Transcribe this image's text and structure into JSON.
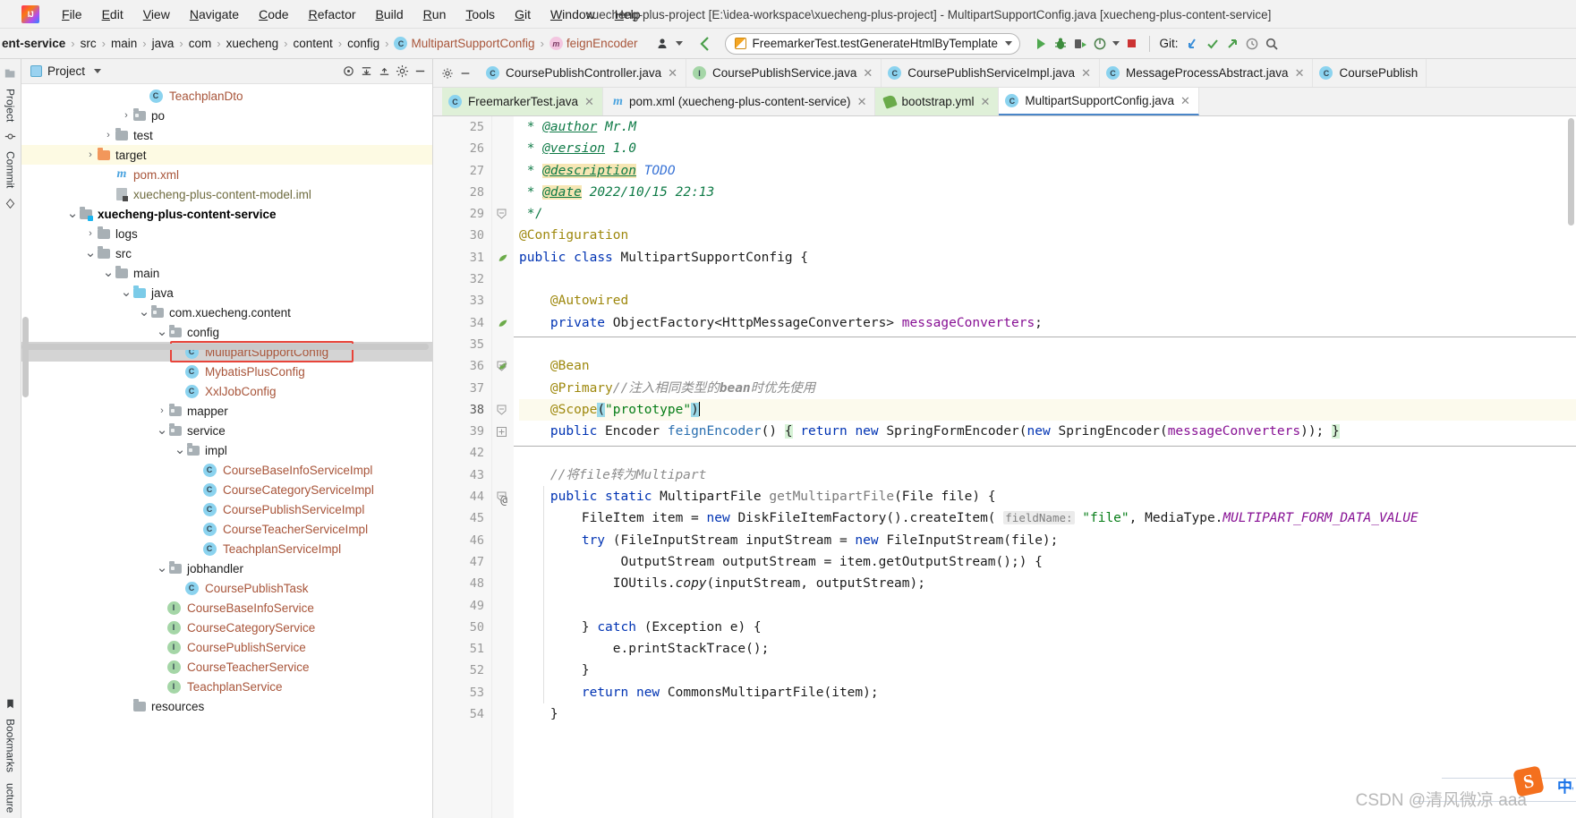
{
  "window": {
    "title": "xuecheng-plus-project [E:\\idea-workspace\\xuecheng-plus-project] - MultipartSupportConfig.java [xuecheng-plus-content-service]",
    "app_icon": "intellij-idea-logo"
  },
  "menubar": {
    "items": [
      {
        "label": "File",
        "mnemonic": "F"
      },
      {
        "label": "Edit",
        "mnemonic": "E"
      },
      {
        "label": "View",
        "mnemonic": "V"
      },
      {
        "label": "Navigate",
        "mnemonic": "N"
      },
      {
        "label": "Code",
        "mnemonic": "C"
      },
      {
        "label": "Refactor",
        "mnemonic": "R"
      },
      {
        "label": "Build",
        "mnemonic": "B"
      },
      {
        "label": "Run",
        "mnemonic": "R"
      },
      {
        "label": "Tools",
        "mnemonic": "T"
      },
      {
        "label": "Git",
        "mnemonic": "G"
      },
      {
        "label": "Window",
        "mnemonic": "W"
      },
      {
        "label": "Help",
        "mnemonic": "H"
      }
    ]
  },
  "navbar": {
    "breadcrumbs": [
      {
        "label": "ent-service",
        "type": "module",
        "bold": true
      },
      {
        "label": "src",
        "type": "dir"
      },
      {
        "label": "main",
        "type": "dir"
      },
      {
        "label": "java",
        "type": "dir"
      },
      {
        "label": "com",
        "type": "dir"
      },
      {
        "label": "xuecheng",
        "type": "dir"
      },
      {
        "label": "content",
        "type": "dir"
      },
      {
        "label": "config",
        "type": "dir"
      },
      {
        "label": "MultipartSupportConfig",
        "type": "class",
        "icon": "class-icon"
      },
      {
        "label": "feignEncoder",
        "type": "method",
        "icon": "method-icon"
      }
    ],
    "run_config": {
      "label": "FreemarkerTest.testGenerateHtmlByTemplate",
      "icon": "run-config-icon"
    },
    "buttons": [
      {
        "name": "run-button",
        "icon": "play-icon",
        "color": "#4fa84f"
      },
      {
        "name": "debug-button",
        "icon": "bug-icon",
        "color": "#3c8c3c"
      },
      {
        "name": "run-with-coverage-button",
        "icon": "coverage-icon"
      },
      {
        "name": "profiler-button",
        "icon": "profiler-icon"
      },
      {
        "name": "stop-button",
        "icon": "stop-icon",
        "color": "#cc3333"
      }
    ],
    "git_label": "Git:",
    "git_buttons": [
      {
        "name": "update-project-button",
        "icon": "update-icon"
      },
      {
        "name": "commit-button",
        "icon": "check-icon"
      },
      {
        "name": "push-button",
        "icon": "push-arrow-icon"
      },
      {
        "name": "history-button",
        "icon": "clock-icon"
      }
    ],
    "search_icon": "search-icon",
    "profiler_icon": "user-profile-icon",
    "back_icon": "back-arrow-icon"
  },
  "left_rail": {
    "items": [
      {
        "label": "Project",
        "name": "tool-window-project"
      },
      {
        "label": "Commit",
        "name": "tool-window-commit"
      },
      {
        "label": "Bookmarks",
        "name": "tool-window-bookmarks"
      },
      {
        "label": "ucture",
        "name": "tool-window-structure"
      }
    ]
  },
  "project_panel": {
    "title": "Project",
    "toolbar_icons": [
      "locate-icon",
      "expand-all-icon",
      "collapse-all-icon",
      "settings-gear-icon",
      "hide-icon"
    ],
    "tree": [
      {
        "label": "TeachplanDto",
        "indent": 7,
        "icon": "class-icon",
        "arrow": "none",
        "kind": "class"
      },
      {
        "label": "po",
        "indent": 6,
        "icon": "package-icon",
        "arrow": "collapsed",
        "kind": "package"
      },
      {
        "label": "test",
        "indent": 5,
        "icon": "folder-icon",
        "arrow": "collapsed",
        "kind": "dir"
      },
      {
        "label": "target",
        "indent": 4,
        "icon": "folder-target-icon",
        "arrow": "collapsed",
        "kind": "dir",
        "highlight": true
      },
      {
        "label": "pom.xml",
        "indent": 5,
        "icon": "maven-icon",
        "arrow": "none",
        "kind": "file"
      },
      {
        "label": "xuecheng-plus-content-model.iml",
        "indent": 5,
        "icon": "iml-icon",
        "arrow": "none",
        "kind": "iml"
      },
      {
        "label": "xuecheng-plus-content-service",
        "indent": 3,
        "icon": "module-icon",
        "arrow": "expanded",
        "kind": "module"
      },
      {
        "label": "logs",
        "indent": 4,
        "icon": "folder-icon",
        "arrow": "collapsed",
        "kind": "dir"
      },
      {
        "label": "src",
        "indent": 4,
        "icon": "folder-icon",
        "arrow": "expanded",
        "kind": "dir"
      },
      {
        "label": "main",
        "indent": 5,
        "icon": "folder-icon",
        "arrow": "expanded",
        "kind": "dir"
      },
      {
        "label": "java",
        "indent": 6,
        "icon": "source-folder-icon",
        "arrow": "expanded",
        "kind": "dir"
      },
      {
        "label": "com.xuecheng.content",
        "indent": 7,
        "icon": "package-icon",
        "arrow": "expanded",
        "kind": "package"
      },
      {
        "label": "config",
        "indent": 8,
        "icon": "package-icon",
        "arrow": "expanded",
        "kind": "package"
      },
      {
        "label": "MultipartSupportConfig",
        "indent": 9,
        "icon": "class-icon",
        "arrow": "none",
        "kind": "class",
        "selected": true,
        "annotated": true
      },
      {
        "label": "MybatisPlusConfig",
        "indent": 9,
        "icon": "class-icon",
        "arrow": "none",
        "kind": "class"
      },
      {
        "label": "XxlJobConfig",
        "indent": 9,
        "icon": "class-icon",
        "arrow": "none",
        "kind": "class"
      },
      {
        "label": "mapper",
        "indent": 8,
        "icon": "package-icon",
        "arrow": "collapsed",
        "kind": "package"
      },
      {
        "label": "service",
        "indent": 8,
        "icon": "package-icon",
        "arrow": "expanded",
        "kind": "package"
      },
      {
        "label": "impl",
        "indent": 9,
        "icon": "package-icon",
        "arrow": "expanded",
        "kind": "package"
      },
      {
        "label": "CourseBaseInfoServiceImpl",
        "indent": 10,
        "icon": "class-icon",
        "arrow": "none",
        "kind": "class"
      },
      {
        "label": "CourseCategoryServiceImpl",
        "indent": 10,
        "icon": "class-icon",
        "arrow": "none",
        "kind": "class"
      },
      {
        "label": "CoursePublishServiceImpl",
        "indent": 10,
        "icon": "class-icon",
        "arrow": "none",
        "kind": "class"
      },
      {
        "label": "CourseTeacherServiceImpl",
        "indent": 10,
        "icon": "class-icon",
        "arrow": "none",
        "kind": "class"
      },
      {
        "label": "TeachplanServiceImpl",
        "indent": 10,
        "icon": "class-icon",
        "arrow": "none",
        "kind": "class"
      },
      {
        "label": "jobhandler",
        "indent": 8,
        "icon": "package-icon",
        "arrow": "expanded",
        "kind": "package"
      },
      {
        "label": "CoursePublishTask",
        "indent": 9,
        "icon": "class-icon",
        "arrow": "none",
        "kind": "class"
      },
      {
        "label": "CourseBaseInfoService",
        "indent": 8,
        "icon": "interface-icon",
        "arrow": "none",
        "kind": "interface"
      },
      {
        "label": "CourseCategoryService",
        "indent": 8,
        "icon": "interface-icon",
        "arrow": "none",
        "kind": "interface"
      },
      {
        "label": "CoursePublishService",
        "indent": 8,
        "icon": "interface-icon",
        "arrow": "none",
        "kind": "interface"
      },
      {
        "label": "CourseTeacherService",
        "indent": 8,
        "icon": "interface-icon",
        "arrow": "none",
        "kind": "interface"
      },
      {
        "label": "TeachplanService",
        "indent": 8,
        "icon": "interface-icon",
        "arrow": "none",
        "kind": "interface"
      },
      {
        "label": "resources",
        "indent": 6,
        "icon": "resource-folder-icon",
        "arrow": "none",
        "kind": "dir"
      }
    ]
  },
  "editor": {
    "tabs_row1": [
      {
        "label": "CoursePublishController.java",
        "icon": "class-icon",
        "active": false,
        "closable": true
      },
      {
        "label": "CoursePublishService.java",
        "icon": "interface-icon",
        "active": false,
        "closable": true
      },
      {
        "label": "CoursePublishServiceImpl.java",
        "icon": "class-icon",
        "active": false,
        "closable": true
      },
      {
        "label": "MessageProcessAbstract.java",
        "icon": "abstract-class-icon",
        "active": false,
        "closable": true
      },
      {
        "label": "CoursePublish",
        "icon": "class-icon",
        "active": false,
        "closable": false
      }
    ],
    "tabs_row2": [
      {
        "label": "FreemarkerTest.java",
        "icon": "test-class-icon",
        "active": false,
        "green": true,
        "closable": true
      },
      {
        "label": "pom.xml (xuecheng-plus-content-service)",
        "icon": "maven-icon",
        "active": false,
        "closable": true
      },
      {
        "label": "bootstrap.yml",
        "icon": "yaml-icon",
        "active": false,
        "green": true,
        "closable": true
      },
      {
        "label": "MultipartSupportConfig.java",
        "icon": "class-icon",
        "active": true,
        "closable": true
      }
    ],
    "first_visible_line": 25,
    "current_line": 38,
    "lines": [
      {
        "n": "25",
        "text": " * @author Mr.M"
      },
      {
        "n": "26",
        "text": " * @version 1.0"
      },
      {
        "n": "27",
        "text": " * @description TODO"
      },
      {
        "n": "28",
        "text": " * @date 2022/10/15 22:13"
      },
      {
        "n": "29",
        "text": " */"
      },
      {
        "n": "30",
        "text": "@Configuration"
      },
      {
        "n": "31",
        "text": "public class MultipartSupportConfig {",
        "gutter_icon": "bean-icon"
      },
      {
        "n": "32",
        "text": ""
      },
      {
        "n": "33",
        "text": "    @Autowired"
      },
      {
        "n": "34",
        "text": "    private ObjectFactory<HttpMessageConverters> messageConverters;",
        "gutter_icon": "bean-inject-icon"
      },
      {
        "n": "35",
        "text": ""
      },
      {
        "n": "36",
        "text": "    @Bean",
        "gutter_icon": "bean-icon"
      },
      {
        "n": "37",
        "text": "    @Primary//注入相同类型的bean时优先使用"
      },
      {
        "n": "38",
        "text": "    @Scope(\"prototype\")",
        "current": true
      },
      {
        "n": "39",
        "text": "    public Encoder feignEncoder() { return new SpringFormEncoder(new SpringEncoder(messageConverters)); }"
      },
      {
        "n": "42",
        "text": ""
      },
      {
        "n": "43",
        "text": "    //将file转为Multipart"
      },
      {
        "n": "44",
        "text": "    public static MultipartFile getMultipartFile(File file) {",
        "gutter_icon": "override-at-icon"
      },
      {
        "n": "45",
        "text": "        FileItem item = new DiskFileItemFactory().createItem( fieldName: \"file\", MediaType.MULTIPART_FORM_DATA_VALUE"
      },
      {
        "n": "46",
        "text": "        try (FileInputStream inputStream = new FileInputStream(file);"
      },
      {
        "n": "47",
        "text": "             OutputStream outputStream = item.getOutputStream();) {"
      },
      {
        "n": "48",
        "text": "            IOUtils.copy(inputStream, outputStream);"
      },
      {
        "n": "49",
        "text": ""
      },
      {
        "n": "50",
        "text": "        } catch (Exception e) {"
      },
      {
        "n": "51",
        "text": "            e.printStackTrace();"
      },
      {
        "n": "52",
        "text": "        }"
      },
      {
        "n": "53",
        "text": "        return new CommonsMultipartFile(item);"
      },
      {
        "n": "54",
        "text": "    }"
      }
    ],
    "inlay_hint": "fieldName:"
  },
  "watermark": {
    "text": "CSDN @清风微凉 aaa",
    "ime_text": "中",
    "sogou_icon": "sogou-ime-icon"
  },
  "colors": {
    "accent": "#4a86c8",
    "selection": "#d4d4d4",
    "highlight_row": "#fdfae3",
    "annotation_box": "#e8443a",
    "keyword": "#0033b3",
    "string": "#067d17",
    "comment": "#8c8c8c",
    "javadoc": "#0e7a46",
    "annotation": "#9e880d",
    "field": "#871094"
  }
}
